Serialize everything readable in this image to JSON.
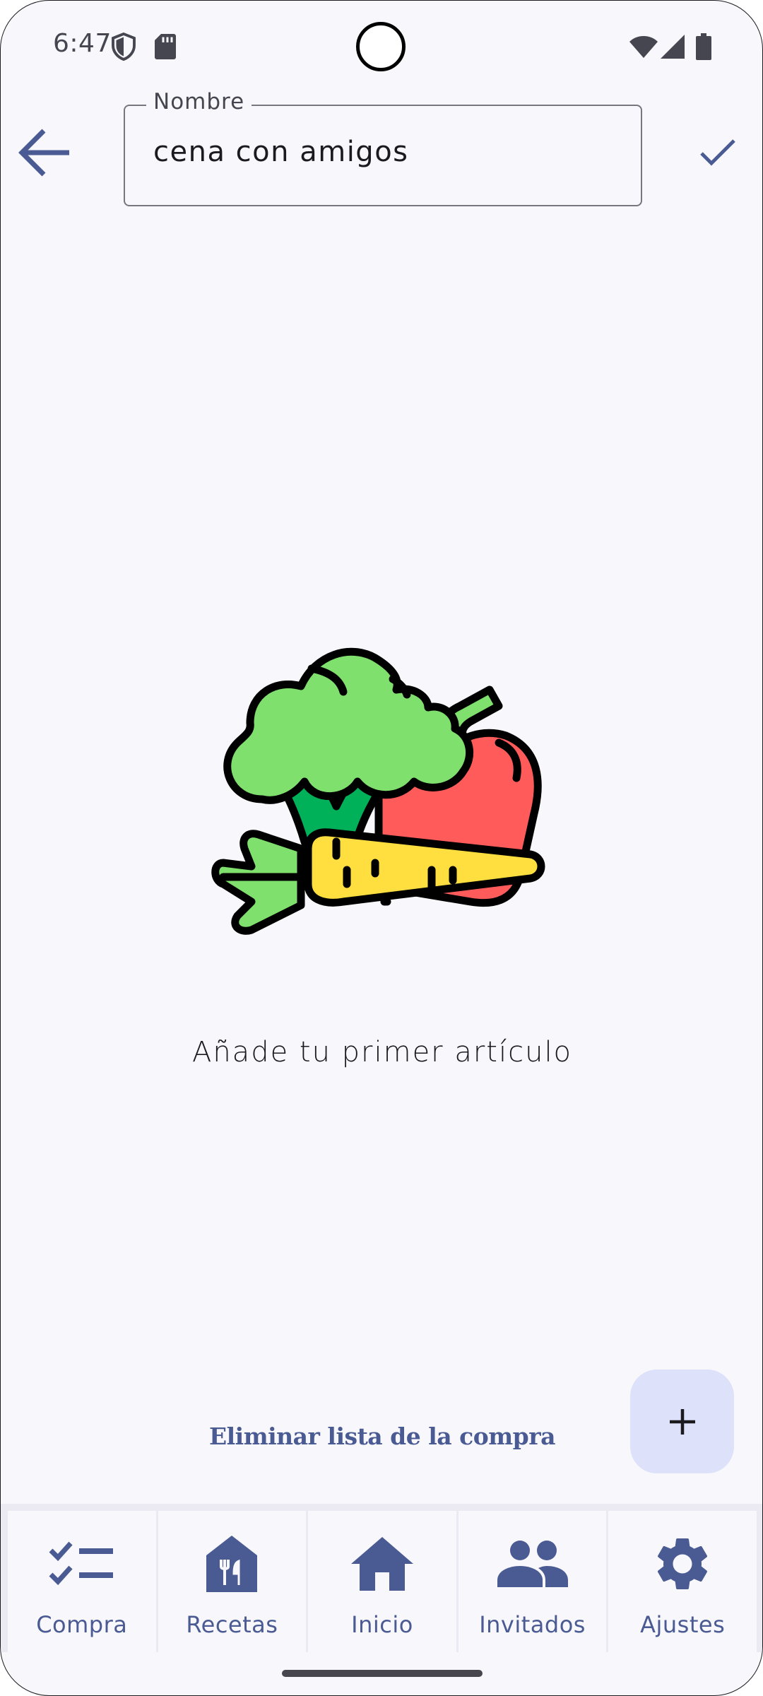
{
  "status_bar": {
    "time": "6:47",
    "icons": [
      "shield-icon",
      "sd-card-icon",
      "wifi-icon",
      "cellular-signal-icon",
      "battery-icon"
    ]
  },
  "top_bar": {
    "back_icon": "arrow-back-icon",
    "name_field": {
      "label": "Nombre",
      "value": "cena con amigos"
    },
    "confirm_icon": "check-icon"
  },
  "empty_state": {
    "illustration": "vegetables-illustration",
    "message": "Añade tu primer artículo"
  },
  "actions": {
    "delete_list": "Eliminar lista de la compra",
    "fab_icon": "plus-icon"
  },
  "bottom_nav": {
    "items": [
      {
        "label": "Compra",
        "icon": "checklist-icon"
      },
      {
        "label": "Recetas",
        "icon": "restaurant-icon"
      },
      {
        "label": "Inicio",
        "icon": "home-icon"
      },
      {
        "label": "Invitados",
        "icon": "people-icon"
      },
      {
        "label": "Ajustes",
        "icon": "settings-icon"
      }
    ]
  },
  "colors": {
    "background": "#f8f7fc",
    "primary": "#4a5a92",
    "fab_container": "#dde1f9",
    "nav_background": "#ebe9f2"
  }
}
